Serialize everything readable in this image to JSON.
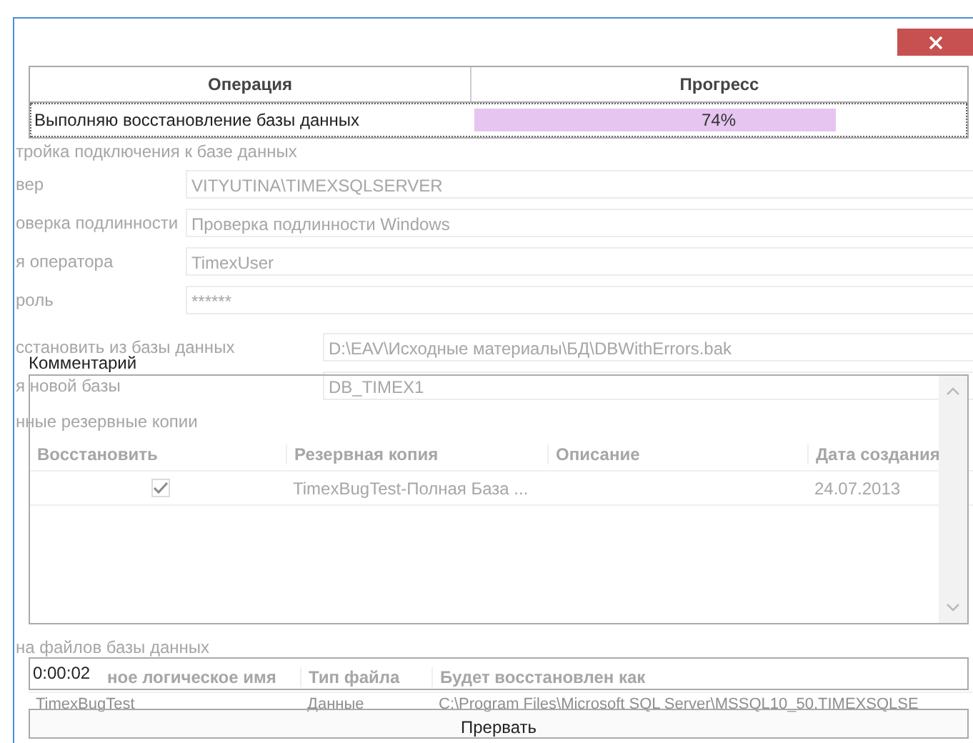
{
  "background_form": {
    "connection_section": "тройка подключения к базе данных",
    "connection_fields": [
      {
        "label": "вер",
        "value": "VITYUTINA\\TIMEXSQLSERVER"
      },
      {
        "label": "оверка подлинности",
        "value": "Проверка подлинности Windows"
      },
      {
        "label": "я оператора",
        "value": "TimexUser"
      },
      {
        "label": "роль",
        "value": "******"
      }
    ],
    "restore_fields": [
      {
        "label": "сстановить из базы данных",
        "value": "D:\\EAV\\Исходные материалы\\БД\\DBWithErrors.bak"
      },
      {
        "label": "я новой базы",
        "value": "DB_TIMEX1"
      }
    ],
    "backups_section": "нные резервные копии",
    "backups_table": {
      "columns": [
        "Восстановить",
        "Резервная копия",
        "Описание",
        "Дата создания"
      ],
      "rows": [
        {
          "checked": true,
          "backup": "TimexBugTest-Полная База ...",
          "date": "24.07.2013"
        }
      ]
    },
    "files_section": "на файлов базы данных",
    "files_table": {
      "columns": [
        "ное логическое имя",
        "Тип файла",
        "Будет восстановлен как"
      ],
      "rows": [
        {
          "cells": [
            "TimexBugTest",
            "Данные",
            "C:\\Program Files\\Microsoft SQL Server\\MSSQL10_50.TIMEXSQLSE"
          ]
        }
      ]
    }
  },
  "progress_dialog": {
    "columns": [
      "Операция",
      "Прогресс"
    ],
    "rows": [
      {
        "operation": "Выполняю восстановление базы данных",
        "level": 0.74,
        "reading": "74%"
      }
    ],
    "comment_label": "Комментарий",
    "elapsed": "0:00:02",
    "cancel_button": "Прервать"
  }
}
